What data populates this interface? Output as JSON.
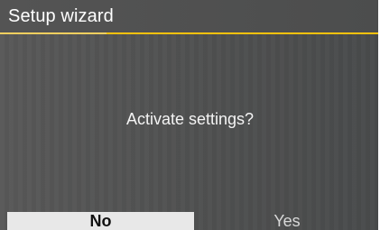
{
  "header": {
    "title": "Setup wizard"
  },
  "dialog": {
    "prompt": "Activate settings?"
  },
  "actions": {
    "no_label": "No",
    "yes_label": "Yes",
    "selected": "No"
  },
  "colors": {
    "accent": "#ffc20e",
    "panel": "#505151",
    "selected_button": "#e8e8e8"
  }
}
